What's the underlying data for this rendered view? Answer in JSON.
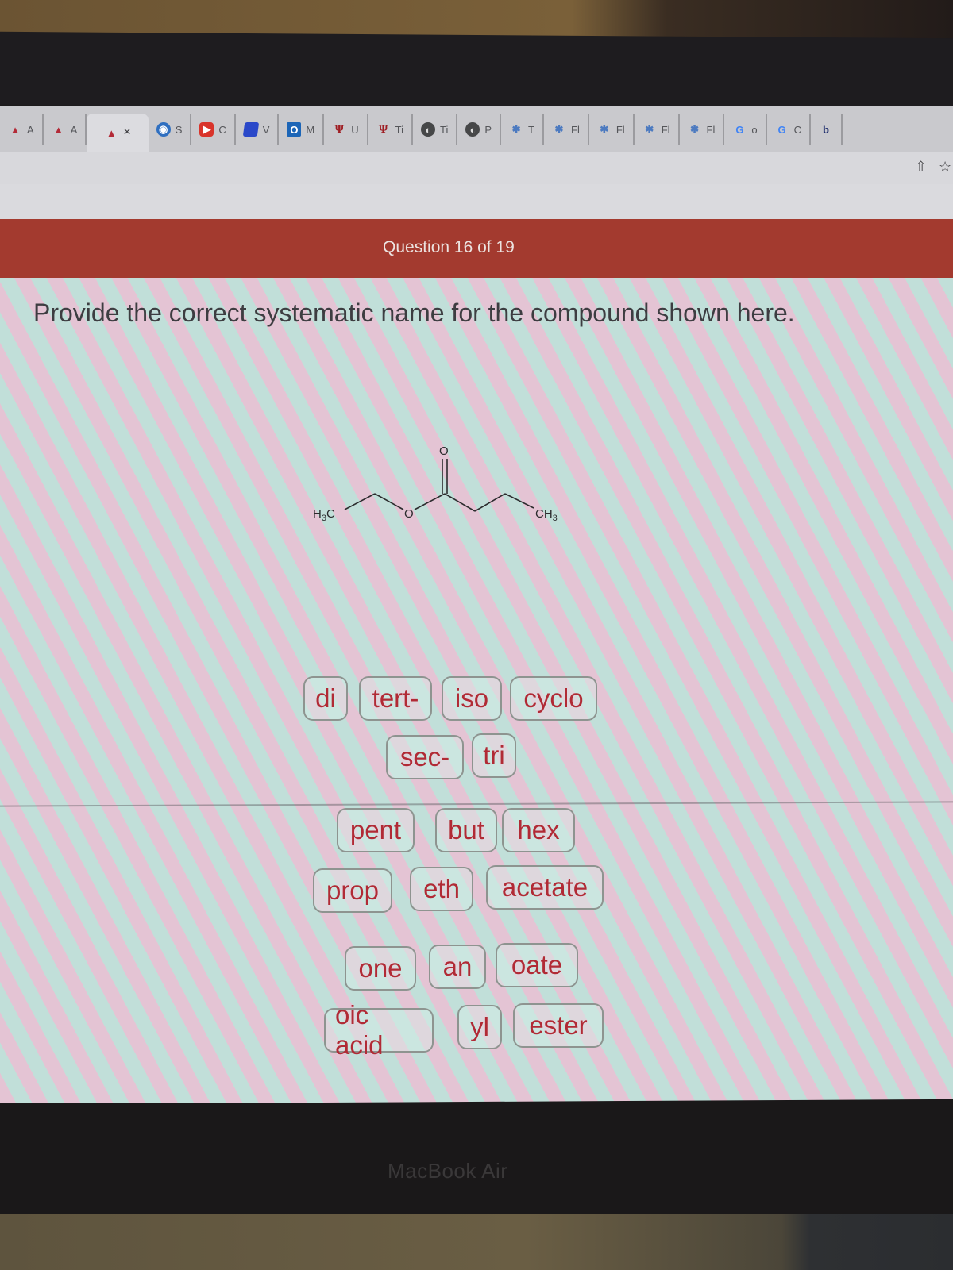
{
  "browser": {
    "tabs": [
      {
        "icon": "aleks-icon",
        "label": "A"
      },
      {
        "icon": "aleks-icon",
        "label": "A"
      },
      {
        "icon": "aleks-icon",
        "label": "×",
        "active": true
      },
      {
        "icon": "blue-circle-icon",
        "label": "S"
      },
      {
        "icon": "youtube-icon",
        "label": "C"
      },
      {
        "icon": "blue-stack-icon",
        "label": "V"
      },
      {
        "icon": "outlook-icon",
        "label": "M"
      },
      {
        "icon": "ut-icon",
        "label": "U"
      },
      {
        "icon": "ut-icon",
        "label": "Ti"
      },
      {
        "icon": "globe-icon",
        "label": "Ti"
      },
      {
        "icon": "globe-icon",
        "label": "P"
      },
      {
        "icon": "spark-icon",
        "label": "T"
      },
      {
        "icon": "spark-icon",
        "label": "Fl"
      },
      {
        "icon": "spark-icon",
        "label": "Fl"
      },
      {
        "icon": "spark-icon",
        "label": "Fl"
      },
      {
        "icon": "spark-icon",
        "label": "Fl"
      },
      {
        "icon": "google-icon",
        "label": "o"
      },
      {
        "icon": "google-icon",
        "label": "C"
      },
      {
        "icon": "b-icon",
        "label": ""
      }
    ],
    "icon_glyphs": {
      "aleks-icon": "▲",
      "blue-circle-icon": "◉",
      "youtube-icon": "▶",
      "blue-stack-icon": "",
      "outlook-icon": "O",
      "ut-icon": "Ψ",
      "globe-icon": "◐",
      "spark-icon": "✱",
      "google-icon": "G",
      "b-icon": "b"
    },
    "toolbar_icons": {
      "share": "⇧",
      "bookmark": "☆"
    }
  },
  "header": {
    "question_counter": "Question 16 of 19",
    "color": "#a33a2f"
  },
  "question": {
    "prompt": "Provide the correct systematic name for the compound shown here.",
    "molecule": {
      "left_label": "H3C",
      "oxygen_label": "O",
      "carbonyl_oxygen_label": "O",
      "right_label": "CH3"
    }
  },
  "word_bank": {
    "tile_color": "#b12a35",
    "rows": [
      [
        "di",
        "tert-",
        "iso",
        "cyclo"
      ],
      [
        "sec-",
        "tri"
      ],
      [
        "pent",
        "but",
        "hex"
      ],
      [
        "prop",
        "eth",
        "acetate"
      ],
      [
        "one",
        "an",
        "oate"
      ],
      [
        "oic acid",
        "yl",
        "ester"
      ]
    ]
  },
  "device": {
    "label": "MacBook Air"
  }
}
